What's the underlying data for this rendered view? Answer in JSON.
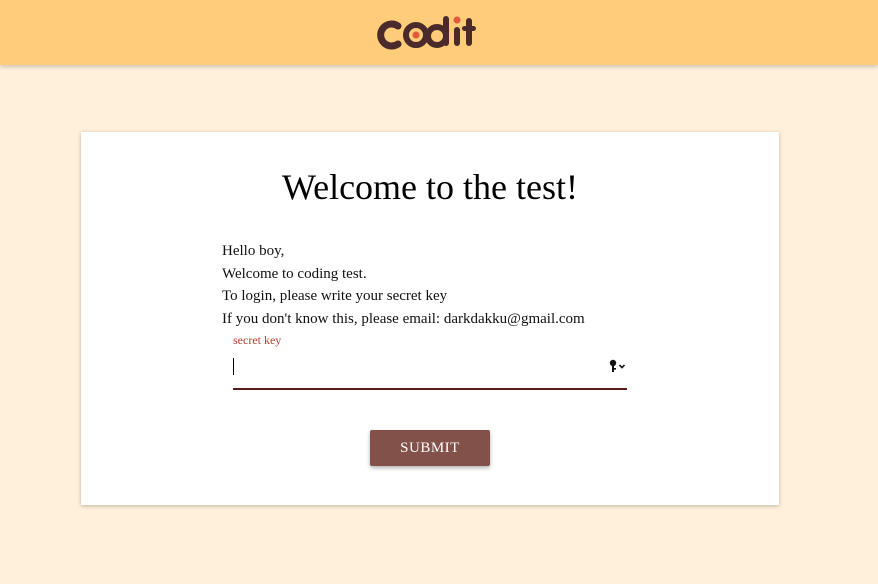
{
  "header": {
    "logo_text": "codit",
    "background_color": "#ffcc7a",
    "logo_color": "#4a2a2a",
    "logo_accent_color": "#e25a3a"
  },
  "card": {
    "title": "Welcome to the test!",
    "intro_lines": [
      "Hello boy,",
      "Welcome to coding test.",
      "To login, please write your secret key",
      "If you don't know this, please email: darkdakku@gmail.com"
    ],
    "secret_key": {
      "label": "secret key",
      "value": "",
      "icon": "key-icon"
    },
    "submit_label": "SUBMIT"
  },
  "colors": {
    "page_background": "#fff0db",
    "button": "#82524a",
    "field_label": "#c0392b"
  }
}
